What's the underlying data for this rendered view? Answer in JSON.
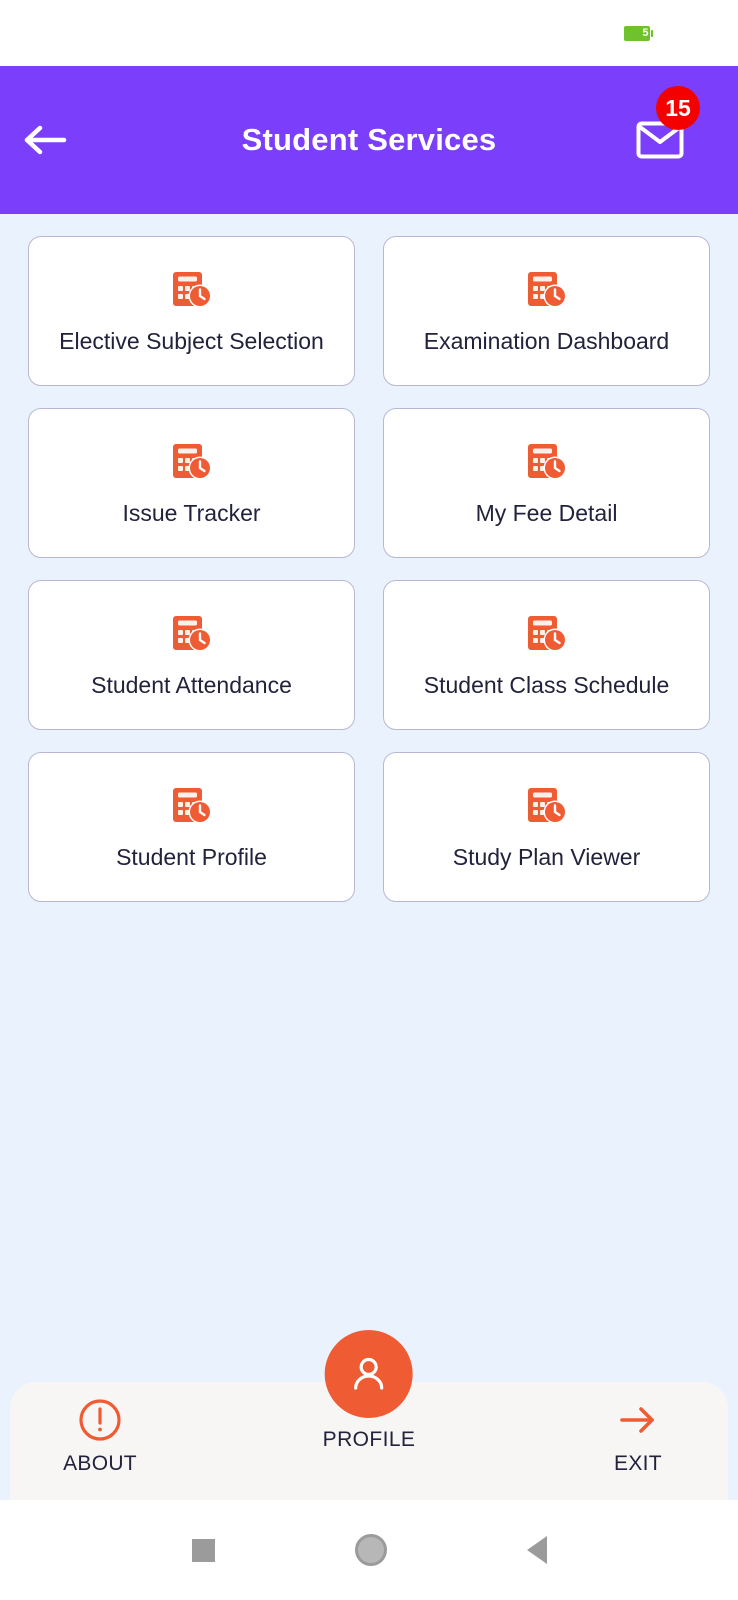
{
  "status_bar": {
    "battery_icon": "battery-icon",
    "battery_level": "5"
  },
  "app_bar": {
    "title": "Student Services",
    "back_icon": "arrow-left-icon",
    "mail_icon": "envelope-icon",
    "mail_badge_count": "15",
    "background_color": "#7b3ffb",
    "badge_color": "#f50000"
  },
  "grid": {
    "icon_color": "#ef5b33",
    "items": [
      {
        "label": "Elective Subject Selection",
        "icon": "calendar-clock-icon"
      },
      {
        "label": "Examination Dashboard",
        "icon": "calendar-clock-icon"
      },
      {
        "label": "Issue Tracker",
        "icon": "calendar-clock-icon"
      },
      {
        "label": "My Fee Detail",
        "icon": "calendar-clock-icon"
      },
      {
        "label": "Student Attendance",
        "icon": "calendar-clock-icon"
      },
      {
        "label": "Student Class Schedule",
        "icon": "calendar-clock-icon"
      },
      {
        "label": "Student Profile",
        "icon": "calendar-clock-icon"
      },
      {
        "label": "Study Plan Viewer",
        "icon": "calendar-clock-icon"
      }
    ]
  },
  "bottom_nav": {
    "accent_color": "#ef5b33",
    "about": {
      "label": "ABOUT",
      "icon": "exclamation-circle-icon"
    },
    "profile": {
      "label": "PROFILE",
      "icon": "person-icon"
    },
    "exit": {
      "label": "EXIT",
      "icon": "arrow-right-icon"
    }
  },
  "android_nav": {
    "recents_icon": "square-icon",
    "home_icon": "circle-icon",
    "back_icon": "triangle-left-icon"
  }
}
